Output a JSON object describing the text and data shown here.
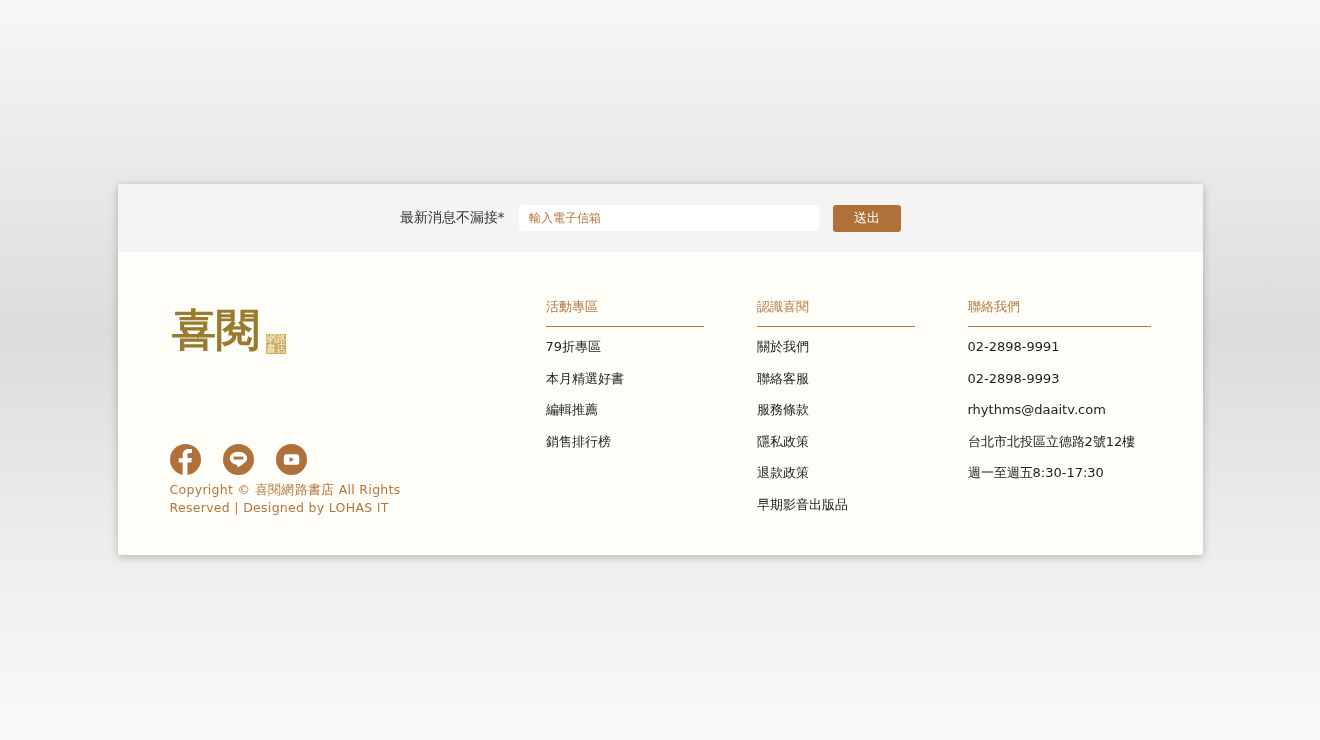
{
  "newsletter": {
    "label": "最新消息不漏接*",
    "placeholder": "輸入電子信箱",
    "button": "送出"
  },
  "logo": {
    "text": "喜閱",
    "seal": "網路書店"
  },
  "social": [
    {
      "kind": "facebook"
    },
    {
      "kind": "line"
    },
    {
      "kind": "youtube"
    }
  ],
  "copyright": "Copyright © 喜閱網路書店 All Rights Reserved | Designed by LOHAS IT",
  "columns": [
    {
      "title": "活動專區",
      "items": [
        "79折專區",
        "本月精選好書",
        "編輯推薦",
        "銷售排行榜"
      ]
    },
    {
      "title": "認識喜閱",
      "items": [
        "關於我們",
        "聯絡客服",
        "服務條款",
        "隱私政策",
        "退款政策",
        "早期影音出版品"
      ]
    },
    {
      "title": "聯絡我們",
      "items": [
        "02-2898-9991",
        "02-2898-9993",
        "rhythms@daaitv.com",
        "台北市北投區立德路2號12樓",
        "週一至週五8:30-17:30"
      ]
    }
  ]
}
